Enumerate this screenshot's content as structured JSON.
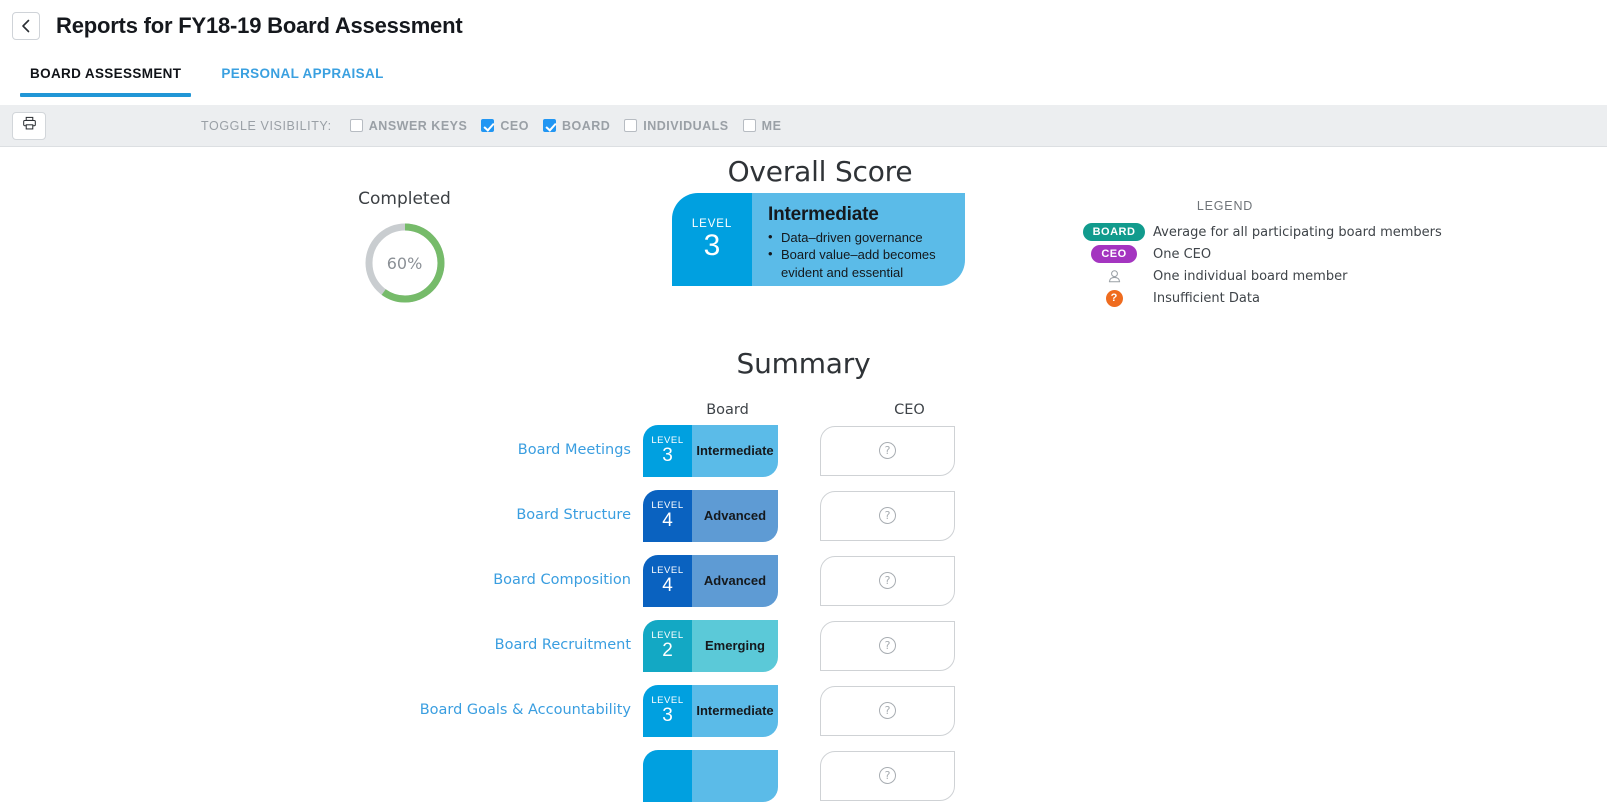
{
  "header": {
    "title": "Reports for FY18-19 Board Assessment",
    "back_icon": "chevron-left-icon"
  },
  "tabs": [
    {
      "label": "BOARD ASSESSMENT",
      "active": true
    },
    {
      "label": "PERSONAL APPRAISAL",
      "active": false
    }
  ],
  "toolbar": {
    "print_icon": "printer-icon",
    "toggle_label": "TOGGLE VISIBILITY:",
    "checkboxes": [
      {
        "label": "ANSWER KEYS",
        "checked": false
      },
      {
        "label": "CEO",
        "checked": true
      },
      {
        "label": "BOARD",
        "checked": true
      },
      {
        "label": "INDIVIDUALS",
        "checked": false
      },
      {
        "label": "ME",
        "checked": false
      }
    ]
  },
  "overall": {
    "title": "Overall Score",
    "completed_label": "Completed",
    "completed_percent": "60%",
    "completed_value": 60,
    "ring_color": "#76bb6a",
    "ring_track_color": "#c9cdd0",
    "level_word": "LEVEL",
    "level_number": "3",
    "level_name": "Intermediate",
    "bullets": [
      "Data–driven governance",
      "Board value–add becomes evident and essential"
    ],
    "level_color": "#00a0e0",
    "body_color": "#5bbbe8"
  },
  "legend": {
    "title": "LEGEND",
    "rows": [
      {
        "icon": "board-badge",
        "badge_text": "BOARD",
        "badge_color": "#119b8d",
        "text": "Average for all participating board members"
      },
      {
        "icon": "ceo-badge",
        "badge_text": "CEO",
        "badge_color": "#a435c0",
        "text": "One CEO"
      },
      {
        "icon": "person-icon",
        "badge_text": "",
        "badge_color": "#9aa0a6",
        "text": "One individual board member"
      },
      {
        "icon": "question-mark-icon",
        "badge_text": "?",
        "badge_color": "#ef6c1f",
        "text": "Insufficient Data"
      }
    ]
  },
  "summary": {
    "title": "Summary",
    "columns": [
      "Board",
      "CEO"
    ],
    "level_word": "LEVEL",
    "empty_icon": "question-circle-icon",
    "rows": [
      {
        "category": "Board Meetings",
        "board_level": "3",
        "board_name": "Intermediate",
        "level_color": "#00a0e0",
        "body_color": "#5bbbe8",
        "ceo": ""
      },
      {
        "category": "Board Structure",
        "board_level": "4",
        "board_name": "Advanced",
        "level_color": "#0a62c0",
        "body_color": "#5e9bd4",
        "ceo": ""
      },
      {
        "category": "Board Composition",
        "board_level": "4",
        "board_name": "Advanced",
        "level_color": "#0a62c0",
        "body_color": "#5e9bd4",
        "ceo": ""
      },
      {
        "category": "Board Recruitment",
        "board_level": "2",
        "board_name": "Emerging",
        "level_color": "#13a8c4",
        "body_color": "#5bc9d8",
        "ceo": ""
      },
      {
        "category": "Board Goals & Accountability",
        "board_level": "3",
        "board_name": "Intermediate",
        "level_color": "#00a0e0",
        "body_color": "#5bbbe8",
        "ceo": ""
      },
      {
        "category": "",
        "board_level": "",
        "board_name": "",
        "level_color": "#00a0e0",
        "body_color": "#5bbbe8",
        "ceo": ""
      }
    ]
  }
}
